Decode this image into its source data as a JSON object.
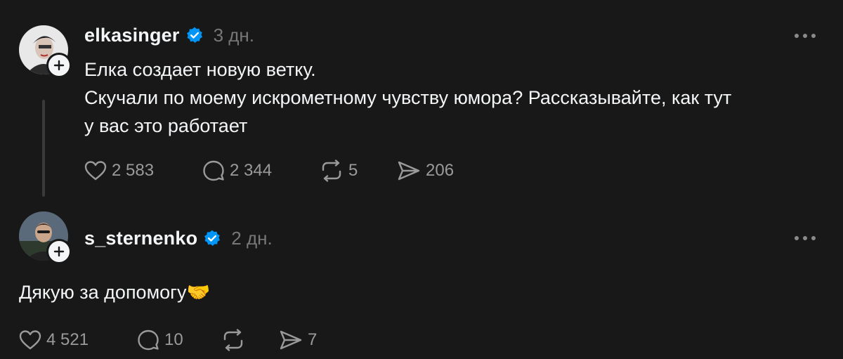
{
  "posts": [
    {
      "username": "elkasinger",
      "time": "3 дн.",
      "text_lines": [
        "Елка создает новую ветку.",
        "Скучали по моему искрометному чувству юмора? Рассказывайте, как тут",
        "у вас это работает"
      ],
      "likes": "2 583",
      "replies": "2 344",
      "reposts": "5",
      "shares": "206"
    },
    {
      "username": "s_sternenko",
      "time": "2 дн.",
      "text": "Дякую за допомогу🤝",
      "likes": "4 521",
      "replies": "10",
      "reposts": "",
      "shares": "7"
    }
  ],
  "icons": {
    "verified": "verified-badge-icon",
    "like": "heart-icon",
    "reply": "speech-bubble-icon",
    "repost": "repost-icon",
    "share": "send-icon",
    "more": "more-icon",
    "follow": "plus-icon"
  },
  "colors": {
    "background": "#181818",
    "verified": "#0095f6",
    "muted": "#777777",
    "text": "#f3f5f7"
  }
}
